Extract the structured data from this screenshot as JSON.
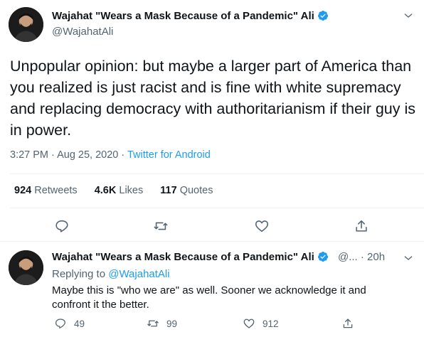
{
  "main_tweet": {
    "display_name": "Wajahat \"Wears a Mask Because of a Pandemic\" Ali",
    "handle": "@WajahatAli",
    "text": "Unpopular opinion: but maybe a larger part of America than you realized is just racist and is fine with white supremacy and replacing democracy with authoritarianism if their guy is in power.",
    "time": "3:27 PM · Aug 25, 2020",
    "separator": " · ",
    "source": "Twitter for Android",
    "stats": {
      "retweets_count": "924",
      "retweets_label": "Retweets",
      "likes_count": "4.6K",
      "likes_label": "Likes",
      "quotes_count": "117",
      "quotes_label": "Quotes"
    }
  },
  "reply_tweet": {
    "display_name": "Wajahat \"Wears a Mask Because of a Pandemic\" Ali",
    "handle_time": "@...  · 20h",
    "replying_prefix": "Replying to ",
    "replying_to": "@WajahatAli",
    "text": "Maybe this is \"who we are\" as well. Sooner we acknowledge it and confront it the better.",
    "reply_count": "49",
    "retweet_count": "99",
    "like_count": "912"
  },
  "colors": {
    "accent": "#1d9bf0",
    "secondary_text": "#536471",
    "primary_text": "#0f1419",
    "divider": "#eff3f4"
  },
  "icons": [
    "verified-badge-icon",
    "chevron-down-icon",
    "reply-icon",
    "retweet-icon",
    "like-icon",
    "share-icon"
  ]
}
